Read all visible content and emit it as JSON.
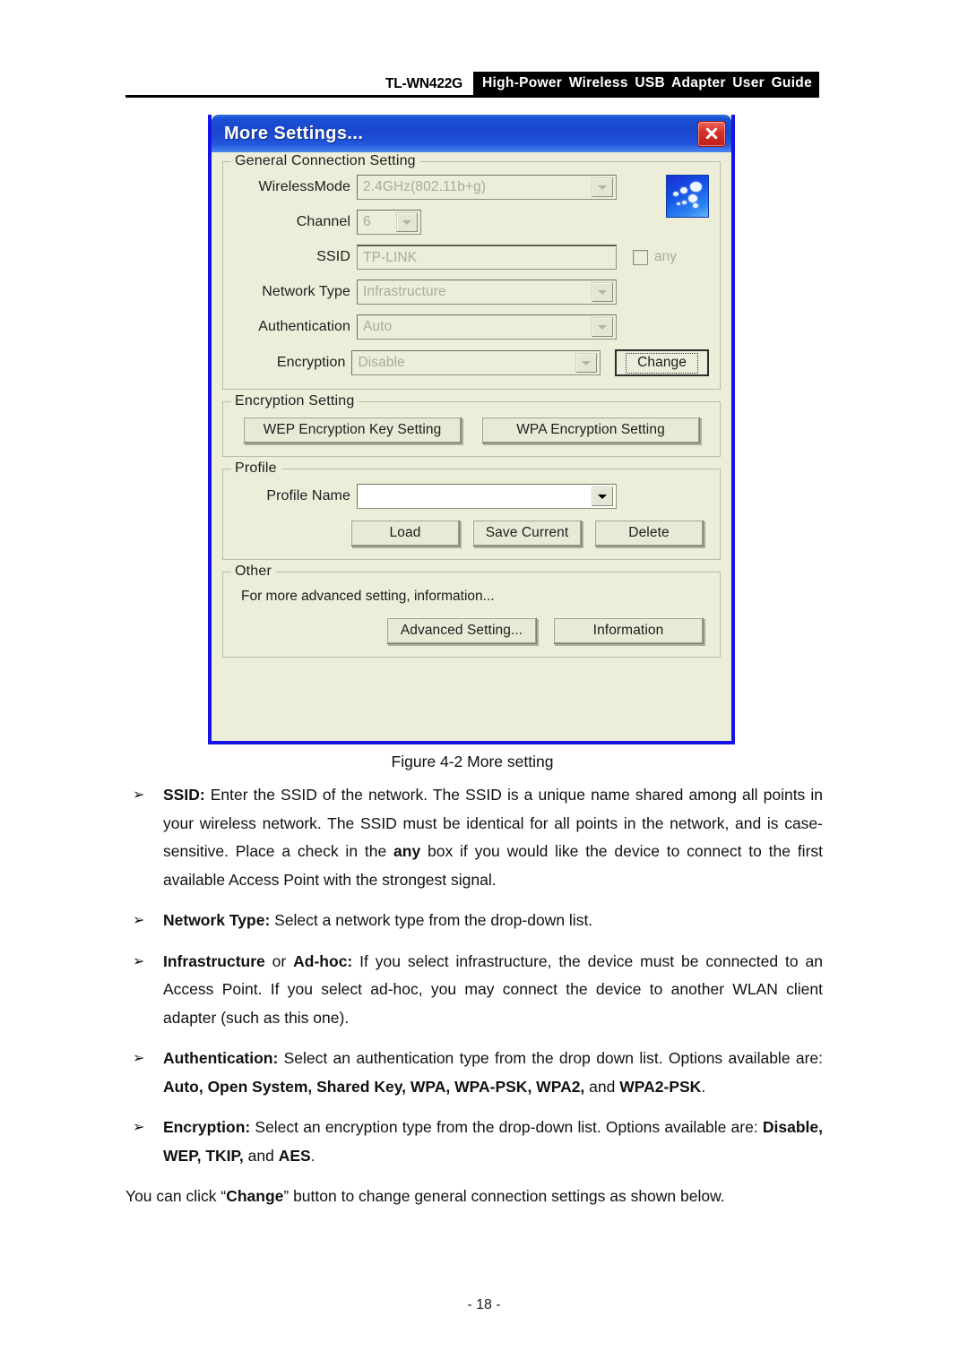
{
  "header": {
    "model": "TL-WN422G",
    "title": "High-Power  Wireless  USB  Adapter  User  Guide"
  },
  "dialog": {
    "title": "More Settings...",
    "close_icon": "close-icon",
    "app_icon": "wireless-signal-icon",
    "general_group": {
      "legend": "General Connection Setting",
      "fields": [
        {
          "label": "WirelessMode",
          "value": "2.4GHz(802.11b+g)",
          "control": "combobox",
          "enabled": false
        },
        {
          "label": "Channel",
          "value": "6",
          "control": "combobox",
          "enabled": false
        },
        {
          "label": "SSID",
          "value": "TP-LINK",
          "control": "textbox",
          "enabled": false
        },
        {
          "label": "Network Type",
          "value": "Infrastructure",
          "control": "combobox",
          "enabled": false
        },
        {
          "label": "Authentication",
          "value": "Auto",
          "control": "combobox",
          "enabled": false
        },
        {
          "label": "Encryption",
          "value": "Disable",
          "control": "combobox",
          "enabled": false
        }
      ],
      "any_checkbox_label": "any",
      "any_checkbox_checked": false,
      "change_button": "Change"
    },
    "encryption_group": {
      "legend": "Encryption Setting",
      "wep_button": "WEP Encryption Key Setting",
      "wpa_button": "WPA Encryption Setting"
    },
    "profile_group": {
      "legend": "Profile",
      "profile_name_label": "Profile Name",
      "profile_name_value": "",
      "load_button": "Load",
      "save_button": "Save Current",
      "delete_button": "Delete"
    },
    "other_group": {
      "legend": "Other",
      "note": "For more advanced setting, information...",
      "advanced_button": "Advanced Setting...",
      "information_button": "Information"
    },
    "colors": {
      "titlebar_blue": "#1b46cd",
      "frame_blue": "#1414e6",
      "close_red": "#bf1d16",
      "dialog_face": "#edeed9"
    }
  },
  "figure": {
    "caption": "Figure 4-2 More setting"
  },
  "bullets": [
    {
      "marker": "➢",
      "parts": [
        {
          "text": "SSID:",
          "bold": true
        },
        {
          "text": " Enter the SSID of the network. The SSID is a unique name shared among all points in your wireless network. The SSID must be identical for all points in the network, and is case-sensitive. Place a check in the ",
          "bold": false
        },
        {
          "text": "any",
          "bold": true
        },
        {
          "text": " box if you would like the device to connect to the first available Access Point with the strongest signal.",
          "bold": false
        }
      ]
    },
    {
      "marker": "➢",
      "parts": [
        {
          "text": "Network Type:",
          "bold": true
        },
        {
          "text": " Select a network type from the drop-down list.",
          "bold": false
        }
      ]
    },
    {
      "marker": "➢",
      "parts": [
        {
          "text": "Infrastructure",
          "bold": true
        },
        {
          "text": " or ",
          "bold": false
        },
        {
          "text": "Ad-hoc:",
          "bold": true
        },
        {
          "text": " If you select infrastructure, the device must be connected to an Access Point. If you select ad-hoc, you may connect the device to another WLAN client adapter (such as this one).",
          "bold": false
        }
      ]
    },
    {
      "marker": "➢",
      "parts": [
        {
          "text": "Authentication:",
          "bold": true
        },
        {
          "text": " Select an authentication type from the drop down list. Options available are: ",
          "bold": false
        },
        {
          "text": "Auto, Open System, Shared Key, WPA, WPA-PSK, WPA2,",
          "bold": true
        },
        {
          "text": " and ",
          "bold": false
        },
        {
          "text": "WPA2-PSK",
          "bold": true
        },
        {
          "text": ".",
          "bold": false
        }
      ]
    },
    {
      "marker": "➢",
      "parts": [
        {
          "text": "Encryption:",
          "bold": true
        },
        {
          "text": " Select an encryption type from the drop-down list. Options available are: ",
          "bold": false
        },
        {
          "text": "Disable, WEP, TKIP,",
          "bold": true
        },
        {
          "text": " and ",
          "bold": false
        },
        {
          "text": "AES",
          "bold": true
        },
        {
          "text": ".",
          "bold": false
        }
      ]
    }
  ],
  "closing_paragraph": {
    "parts": [
      {
        "text": "You can click “",
        "bold": false
      },
      {
        "text": "Change",
        "bold": true
      },
      {
        "text": "” button to change general connection settings as shown below.",
        "bold": false
      }
    ]
  },
  "footer": {
    "page_number": "- 18 -"
  }
}
